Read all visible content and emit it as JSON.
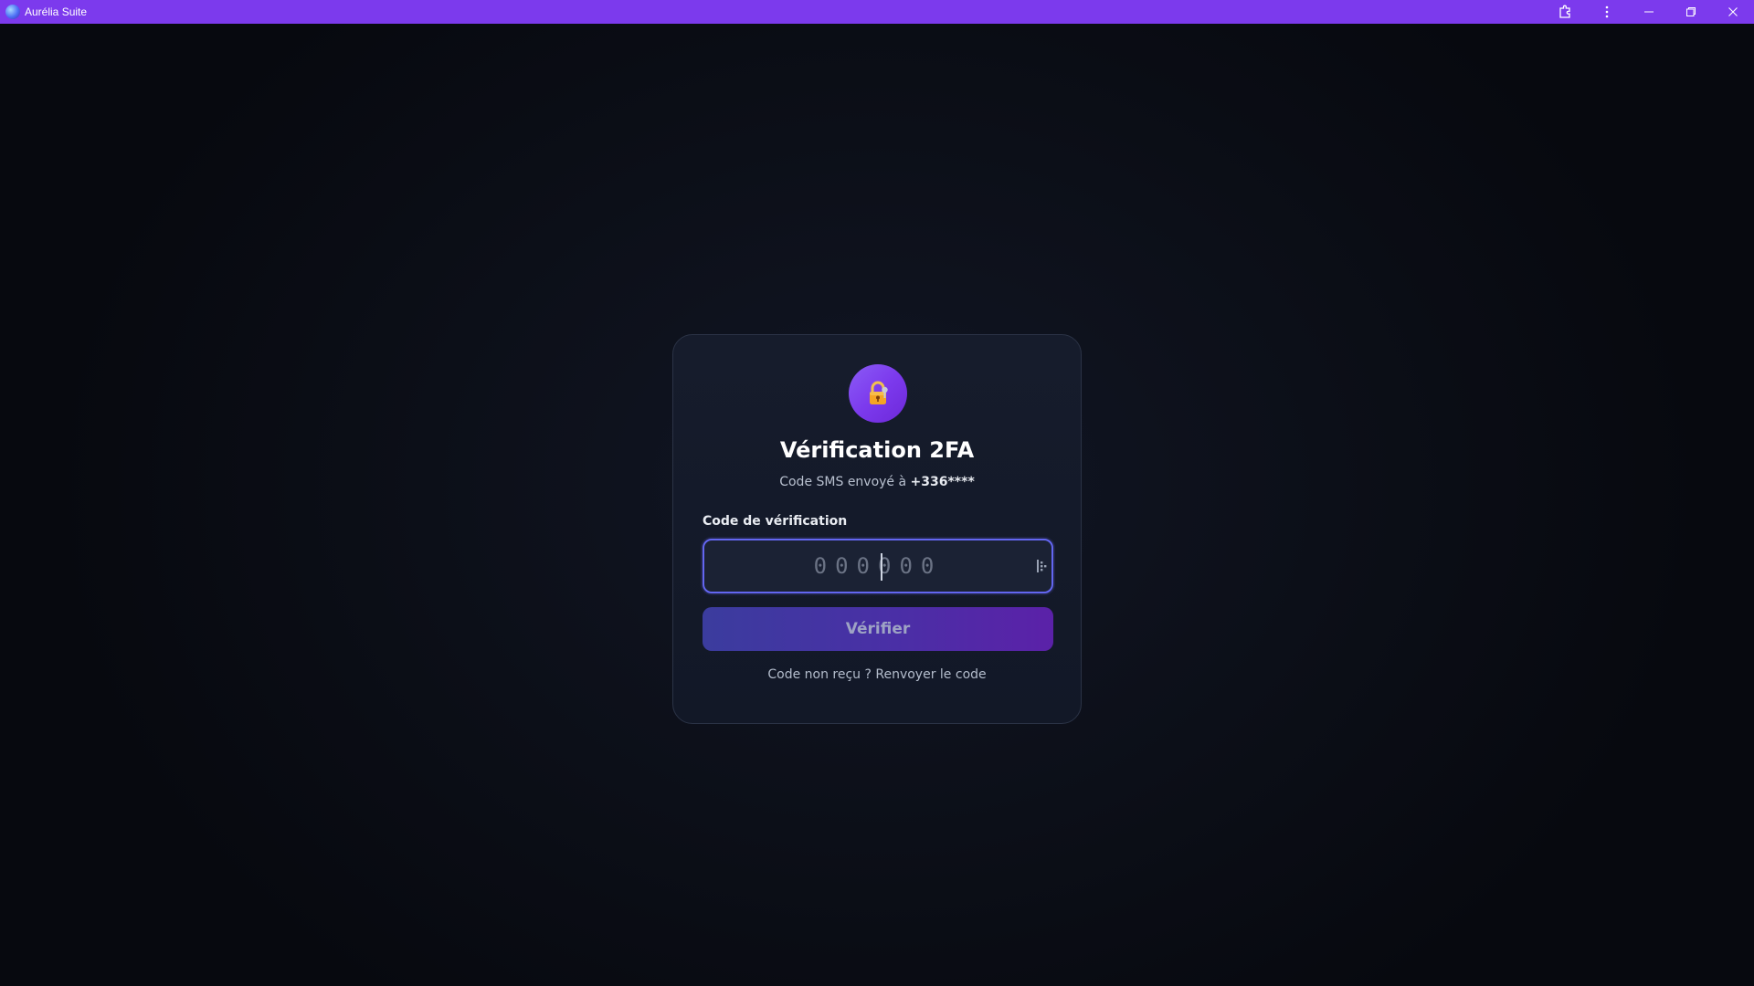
{
  "window": {
    "title": "Aurélia Suite",
    "controls": [
      "extensions-icon",
      "more-icon",
      "minimize-icon",
      "restore-icon",
      "close-icon"
    ]
  },
  "card": {
    "icon": "lock-icon",
    "title": "Vérification 2FA",
    "subtitle_prefix": "Code SMS envoyé à ",
    "phone_masked": "+336****",
    "field_label": "Code de vérification",
    "code_placeholder": "000000",
    "verify_label": "Vérifier",
    "resend_prefix": "Code non reçu ? ",
    "resend_link": "Renvoyer le code"
  },
  "colors": {
    "titlebar": "#7c3aed",
    "accent": "#6366f1",
    "badge": "#7c3aed",
    "background": "#0b0d14"
  }
}
